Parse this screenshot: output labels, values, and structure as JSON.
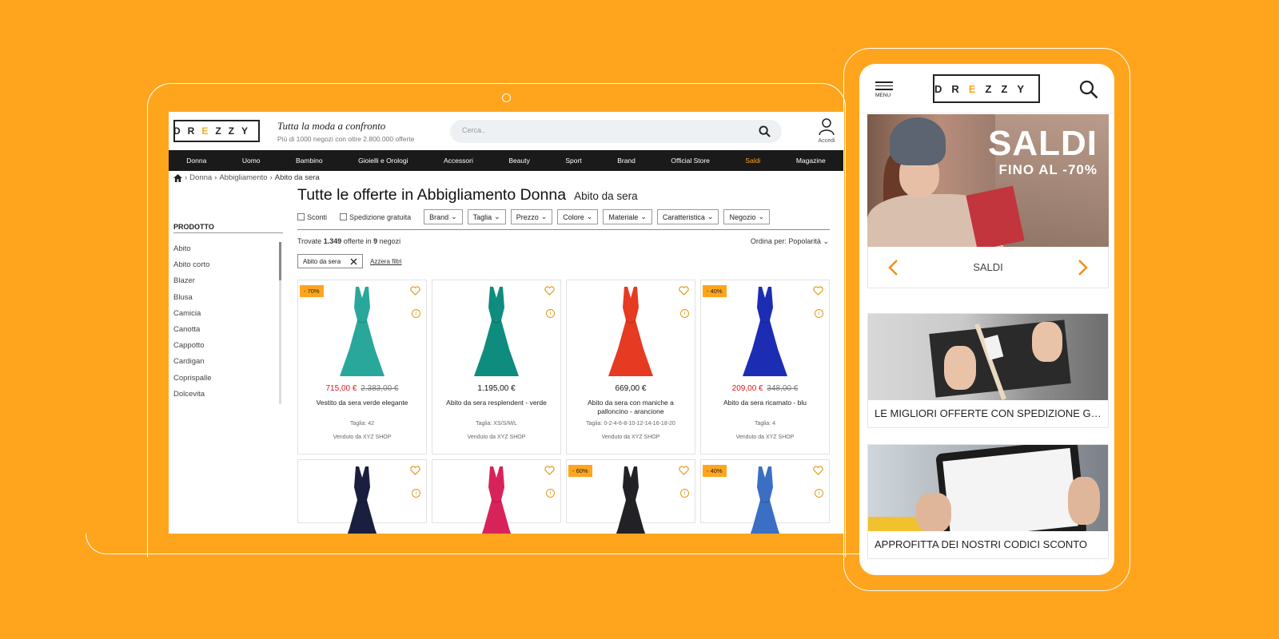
{
  "colors": {
    "accent": "#FFA51D",
    "sale_red": "#E2161C",
    "nav_bg": "#1a1a1a"
  },
  "desktop": {
    "logo": {
      "letters": [
        "D",
        "R",
        "Z",
        "Z",
        "Y"
      ],
      "accent_letter": "E"
    },
    "tagline": "Tutta la moda a confronto",
    "subtagline": "Più di 1000 negozi con oltre 2.800.000 offerte",
    "search_placeholder": "Cerca..",
    "account_label": "Accedi",
    "nav": [
      "Donna",
      "Uomo",
      "Bambino",
      "Gioielli e Orologi",
      "Accessori",
      "Beauty",
      "Sport",
      "Brand",
      "Official Store",
      "Saldi",
      "Magazine"
    ],
    "breadcrumb": [
      "Donna",
      "Abbigliamento",
      "Abito da sera"
    ],
    "sidebar": {
      "title": "PRODOTTO",
      "items": [
        "Abito",
        "Abito corto",
        "Blazer",
        "Blusa",
        "Camicia",
        "Canotta",
        "Cappotto",
        "Cardigan",
        "Coprispalle",
        "Dolcevita"
      ]
    },
    "title": "Tutte le offerte in Abbigliamento Donna",
    "title_sub": "Abito da sera",
    "checkboxes": [
      "Sconti",
      "Spedizione gratuita"
    ],
    "filters": [
      "Brand",
      "Taglia",
      "Prezzo",
      "Colore",
      "Materiale",
      "Caratteristica",
      "Negozio"
    ],
    "found": {
      "prefix": "Trovate",
      "count": "1.349",
      "mid": "offerte in",
      "shops": "9",
      "suffix": "negozi"
    },
    "sort": "Ordina per: Popolarità",
    "active_chip": "Abito da sera",
    "reset": "Azzera filtri",
    "products": [
      {
        "badge": "- 70%",
        "price": "715,00 €",
        "old_price": "2.383,00 €",
        "name": "Vestito da sera verde elegante",
        "size": "Taglia: 42",
        "seller": "Venduto da XYZ SHOP",
        "dress_color": "#2AA79B"
      },
      {
        "badge": "",
        "price": "1.195,00 €",
        "old_price": "",
        "name": "Abito da sera resplendent - verde",
        "size": "Taglia: XS/S/M/L",
        "seller": "Venduto da XYZ SHOP",
        "dress_color": "#0E8C7E"
      },
      {
        "badge": "",
        "price": "669,00 €",
        "old_price": "",
        "name": "Abito da sera con maniche a palloncino - arancione",
        "size": "Taglia: 0-2-4-6-8-10-12-14-16-18-20",
        "seller": "Venduto da XYZ SHOP",
        "dress_color": "#E63A22"
      },
      {
        "badge": "- 40%",
        "price": "209,00 €",
        "old_price": "348,00 €",
        "name": "Abito da sera ricamato - blu",
        "size": "Taglia: 4",
        "seller": "Venduto da XYZ SHOP",
        "dress_color": "#1C2DB4"
      },
      {
        "badge": "",
        "dress_color": "#1A1F3F"
      },
      {
        "badge": "",
        "dress_color": "#D8235A"
      },
      {
        "badge": "- 60%",
        "dress_color": "#222226"
      },
      {
        "badge": "- 40%",
        "dress_color": "#3A6FC4"
      }
    ]
  },
  "mobile": {
    "menu_label": "MENU",
    "hero_title": "SALDI",
    "hero_sub": "FINO AL -70%",
    "carousel_label": "SALDI",
    "promos": [
      "LE MIGLIORI OFFERTE CON SPEDIZIONE GRATUITA",
      "APPROFITTA DEI NOSTRI CODICI SCONTO"
    ]
  }
}
